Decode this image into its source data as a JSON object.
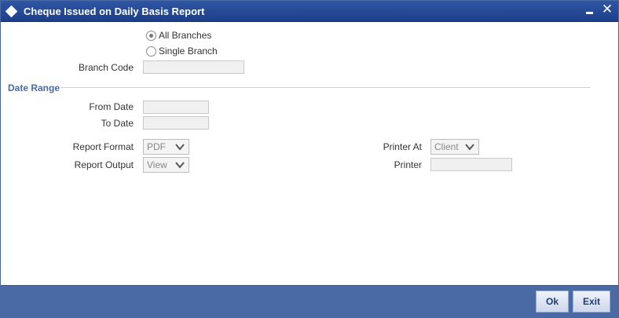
{
  "window": {
    "title": "Cheque Issued on Daily Basis Report"
  },
  "branch_selection": {
    "options": [
      {
        "label": "All Branches",
        "checked": true
      },
      {
        "label": "Single Branch",
        "checked": false
      }
    ],
    "branch_code_label": "Branch Code",
    "branch_code_value": ""
  },
  "date_range": {
    "section_title": "Date Range",
    "from_label": "From Date",
    "from_value": "",
    "to_label": "To Date",
    "to_value": ""
  },
  "report": {
    "format_label": "Report Format",
    "format_value": "PDF",
    "output_label": "Report Output",
    "output_value": "View",
    "printer_at_label": "Printer At",
    "printer_at_value": "Client",
    "printer_label": "Printer",
    "printer_value": ""
  },
  "footer": {
    "ok_label": "Ok",
    "exit_label": "Exit"
  },
  "colors": {
    "titlebar": "#1d3f8a",
    "footer": "#4a6aa5",
    "section_title": "#4a6aa5"
  }
}
